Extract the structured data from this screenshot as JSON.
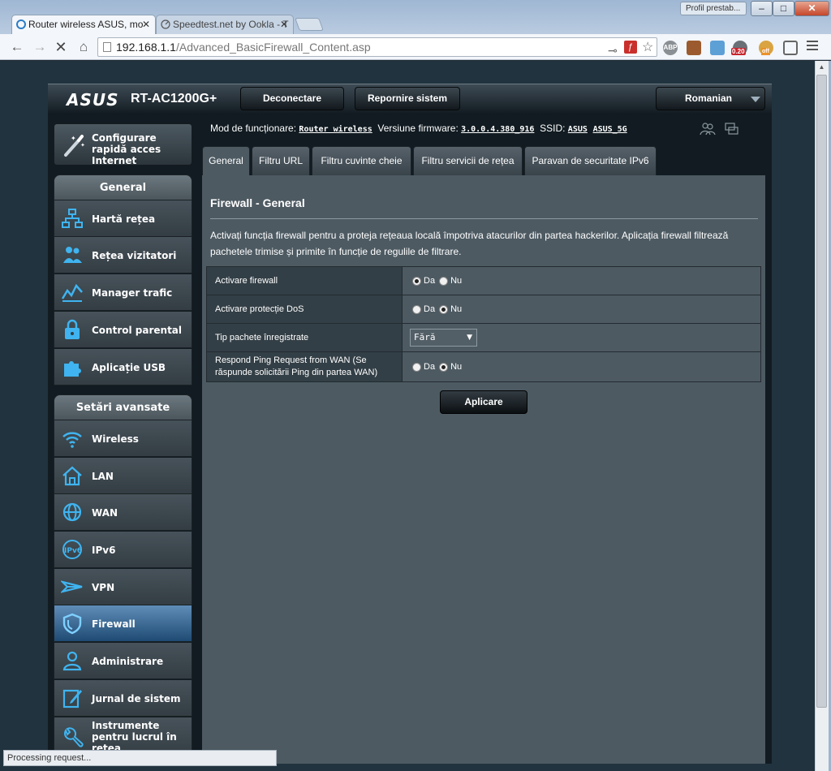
{
  "browser": {
    "profile_label": "Profil prestab...",
    "tabs": [
      {
        "title": "Router wireless ASUS, mo",
        "active": true
      },
      {
        "title": "Speedtest.net by Ookla - T",
        "active": false
      }
    ],
    "url_host": "192.168.1.1",
    "url_path": "/Advanced_BasicFirewall_Content.asp",
    "status_text": "Processing request...",
    "extension_badges": {
      "abp": "ABP",
      "speed": "0.20",
      "off": "off"
    }
  },
  "router": {
    "brand": "ASUS",
    "model": "RT-AC1200G+",
    "top_buttons": {
      "logout": "Deconectare",
      "reboot": "Repornire sistem"
    },
    "language": "Romanian",
    "status": {
      "mode_label": "Mod de funcționare:",
      "mode_value": "Router wireless",
      "firmware_label": "Versiune firmware:",
      "firmware_value": "3.0.0.4.380_916",
      "ssid_label": "SSID:",
      "ssid_values": [
        "ASUS",
        "ASUS_5G"
      ]
    },
    "quick_setup_label": "Configurare rapidă acces Internet",
    "sidebar": {
      "general_header": "General",
      "general_items": [
        {
          "label": "Hartă rețea",
          "icon": "network-map-icon"
        },
        {
          "label": "Rețea vizitatori",
          "icon": "guest-network-icon"
        },
        {
          "label": "Manager trafic",
          "icon": "traffic-manager-icon"
        },
        {
          "label": "Control parental",
          "icon": "parental-control-icon"
        },
        {
          "label": "Aplicație USB",
          "icon": "usb-app-icon"
        }
      ],
      "advanced_header": "Setări avansate",
      "advanced_items": [
        {
          "label": "Wireless",
          "icon": "wireless-icon"
        },
        {
          "label": "LAN",
          "icon": "lan-icon"
        },
        {
          "label": "WAN",
          "icon": "wan-icon"
        },
        {
          "label": "IPv6",
          "icon": "ipv6-icon"
        },
        {
          "label": "VPN",
          "icon": "vpn-icon"
        },
        {
          "label": "Firewall",
          "icon": "firewall-icon",
          "active": true
        },
        {
          "label": "Administrare",
          "icon": "admin-icon"
        },
        {
          "label": "Jurnal de sistem",
          "icon": "system-log-icon"
        },
        {
          "label": "Instrumente pentru lucrul în rețea",
          "icon": "network-tools-icon"
        }
      ]
    },
    "tabs": [
      "General",
      "Filtru URL",
      "Filtru cuvinte cheie",
      "Filtru servicii de rețea",
      "Paravan de securitate IPv6"
    ],
    "active_tab": "General",
    "panel": {
      "title": "Firewall - General",
      "description": "Activați funcția firewall pentru a proteja rețeaua locală împotriva atacurilor din partea hackerilor. Aplicația firewall filtrează pachetele trimise și primite în funcție de regulile de filtrare.",
      "rows": [
        {
          "label": "Activare firewall",
          "type": "radio",
          "options": [
            "Da",
            "Nu"
          ],
          "selected": "Da"
        },
        {
          "label": "Activare protecție DoS",
          "type": "radio",
          "options": [
            "Da",
            "Nu"
          ],
          "selected": "Nu"
        },
        {
          "label": "Tip pachete înregistrate",
          "type": "select",
          "value": "Fără"
        },
        {
          "label": "Respond Ping Request from WAN (Se răspunde solicitării Ping din partea WAN)",
          "type": "radio",
          "options": [
            "Da",
            "Nu"
          ],
          "selected": "Nu"
        }
      ],
      "apply_label": "Aplicare"
    }
  }
}
